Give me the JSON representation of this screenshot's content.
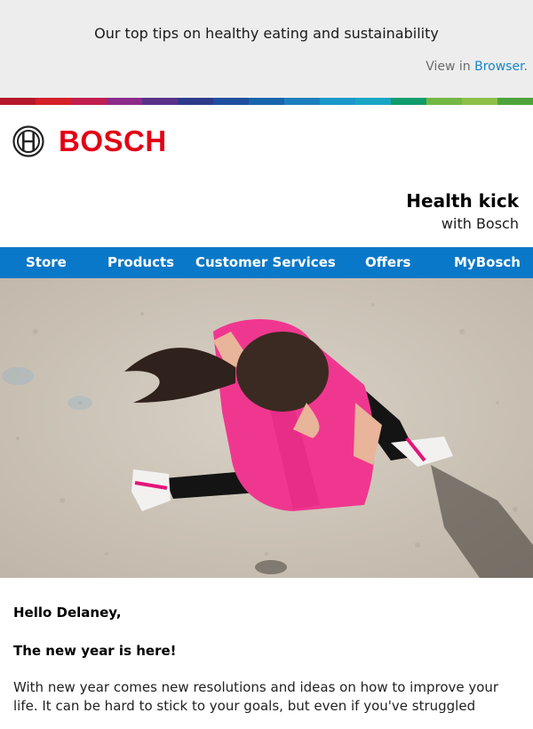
{
  "preheader": {
    "text": "Our top tips on healthy eating and sustainability",
    "view_prefix": "View in",
    "view_link": "Browser",
    "view_suffix": "."
  },
  "brand": {
    "wordmark": "BOSCH",
    "color": "#e20015"
  },
  "rainbow_colors": [
    "#b5172b",
    "#d42027",
    "#c01f4f",
    "#8c2b8a",
    "#5a3189",
    "#2e3b8b",
    "#1e4f9e",
    "#1765ad",
    "#1d7fbf",
    "#1a97c9",
    "#17a6c4",
    "#0e9c6b",
    "#73b744",
    "#8dc048",
    "#4ea33d"
  ],
  "headline": {
    "title": "Health kick",
    "subtitle": "with Bosch"
  },
  "nav": {
    "color": "#0a78c8",
    "items": [
      {
        "label": "Store"
      },
      {
        "label": "Products"
      },
      {
        "label": "Customer Services"
      },
      {
        "label": "Offers"
      },
      {
        "label": "MyBosch"
      }
    ]
  },
  "hero": {
    "alt_description": "woman-running-pink-shirt"
  },
  "content": {
    "greeting": "Hello Delaney,",
    "subhead": "The new year is here!",
    "paragraph": "With new year comes new resolutions and ideas on how to improve your life. It can be hard to stick to your goals, but even if you've struggled"
  }
}
